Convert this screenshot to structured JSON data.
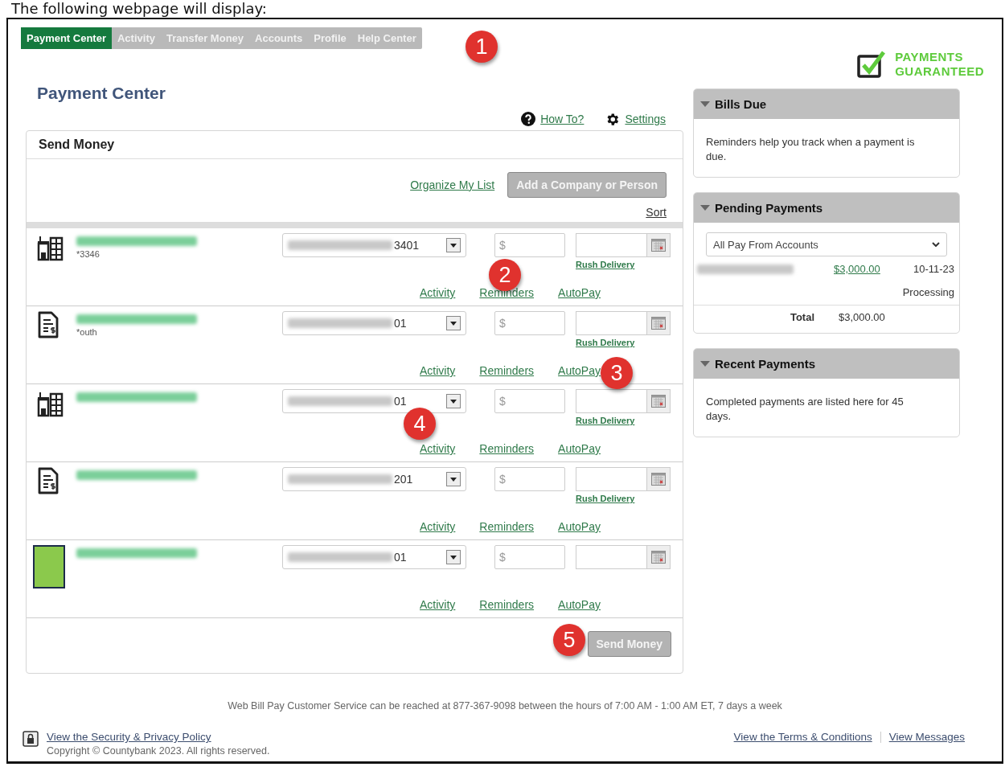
{
  "doc_caption": "The following webpage will display:",
  "nav": [
    {
      "label": "Payment Center",
      "selected": true
    },
    {
      "label": "Activity",
      "selected": false
    },
    {
      "label": "Transfer Money",
      "selected": false
    },
    {
      "label": "Accounts",
      "selected": false
    },
    {
      "label": "Profile",
      "selected": false
    },
    {
      "label": "Help Center",
      "selected": false
    }
  ],
  "badge": {
    "line1": "PAYMENTS",
    "line2": "GUARANTEED"
  },
  "page_title": "Payment Center",
  "help_links": [
    {
      "kind": "help",
      "label": "How To?"
    },
    {
      "kind": "settings",
      "label": "Settings"
    }
  ],
  "send_money": {
    "title": "Send Money",
    "organize_link": "Organize My List",
    "add_button": "Add a Company or Person",
    "sort_link": "Sort",
    "payees": [
      {
        "kind": "company",
        "account": "*3346",
        "pay_from": "3401",
        "amount_placeholder": "$",
        "rush_delivery": "Rush Delivery",
        "links": [
          "Activity",
          "Reminders",
          "AutoPay"
        ]
      },
      {
        "kind": "bill",
        "account": "*outh",
        "pay_from": "01",
        "amount_placeholder": "$",
        "rush_delivery": "Rush Delivery",
        "links": [
          "Activity",
          "Reminders",
          "AutoPay"
        ]
      },
      {
        "kind": "company",
        "pay_from": "01",
        "amount_placeholder": "$",
        "rush_delivery": "Rush Delivery",
        "links": [
          "Activity",
          "Reminders",
          "AutoPay"
        ]
      },
      {
        "kind": "bill",
        "pay_from": "201",
        "amount_placeholder": "$",
        "rush_delivery": "Rush Delivery",
        "links": [
          "Activity",
          "Reminders",
          "AutoPay"
        ]
      },
      {
        "kind": "redacted",
        "pay_from": "01",
        "amount_placeholder": "$",
        "links": [
          "Activity",
          "Reminders",
          "AutoPay"
        ]
      }
    ],
    "submit": "Send Money"
  },
  "bills_due": {
    "title": "Bills Due",
    "expanded": true,
    "text": "Reminders help you track when a payment is due."
  },
  "pending": {
    "title": "Pending Payments",
    "expanded": true,
    "account_select": "All Pay From Accounts",
    "items": [
      {
        "amount": "$3,000.00",
        "date": "10-11-23",
        "status": "Processing"
      }
    ],
    "total_label": "Total",
    "total": "$3,000.00"
  },
  "recent": {
    "title": "Recent Payments",
    "expanded": true,
    "text": "Completed payments are listed here for 45 days."
  },
  "footer": {
    "service": "Web Bill Pay Customer Service can be reached at 877-367-9098 between the hours of 7:00 AM - 1:00 AM ET, 7 days a week",
    "security_link": "View the Security & Privacy Policy",
    "copyright": "Copyright © Countybank 2023. All rights reserved.",
    "links": [
      "View the Terms & Conditions",
      "View Messages"
    ]
  },
  "annotations": [
    "1",
    "2",
    "3",
    "4",
    "5"
  ]
}
